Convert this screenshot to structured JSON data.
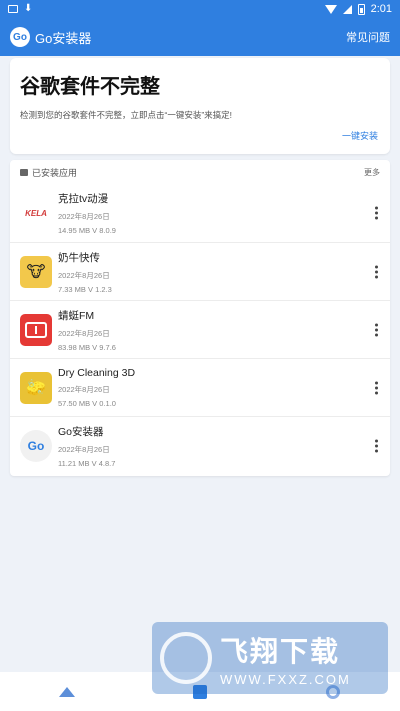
{
  "status_bar": {
    "time": "2:01"
  },
  "app_bar": {
    "logo_text": "Go",
    "title": "Go安装器",
    "faq_label": "常见问题"
  },
  "banner": {
    "headline": "谷歌套件不完整",
    "description": "检测到您的谷歌套件不完整，立即点击“一键安装”来搞定!",
    "action_label": "一键安装"
  },
  "installed": {
    "header_label": "已安装应用",
    "more_label": "更多",
    "apps": [
      {
        "name": "克拉tv动漫",
        "date": "2022年8月26日",
        "meta": "14.95 MB  V 8.0.9",
        "icon": "kela-tv-icon",
        "icon_text": "KELA"
      },
      {
        "name": "奶牛快传",
        "date": "2022年8月26日",
        "meta": "7.33 MB  V 1.2.3",
        "icon": "cow-icon",
        "icon_text": "🐮"
      },
      {
        "name": "蜻蜓FM",
        "date": "2022年8月26日",
        "meta": "83.98 MB  V 9.7.6",
        "icon": "radio-icon",
        "icon_text": ""
      },
      {
        "name": "Dry Cleaning 3D",
        "date": "2022年8月26日",
        "meta": "57.50 MB  V 0.1.0",
        "icon": "dry-cleaning-icon",
        "icon_text": "🧽"
      },
      {
        "name": "Go安装器",
        "date": "2022年8月26日",
        "meta": "11.21 MB  V 4.8.7",
        "icon": "go-installer-icon",
        "icon_text": "Go"
      }
    ]
  },
  "watermark": {
    "text": "飞翔下载",
    "url": "WWW.FXXZ.COM"
  }
}
